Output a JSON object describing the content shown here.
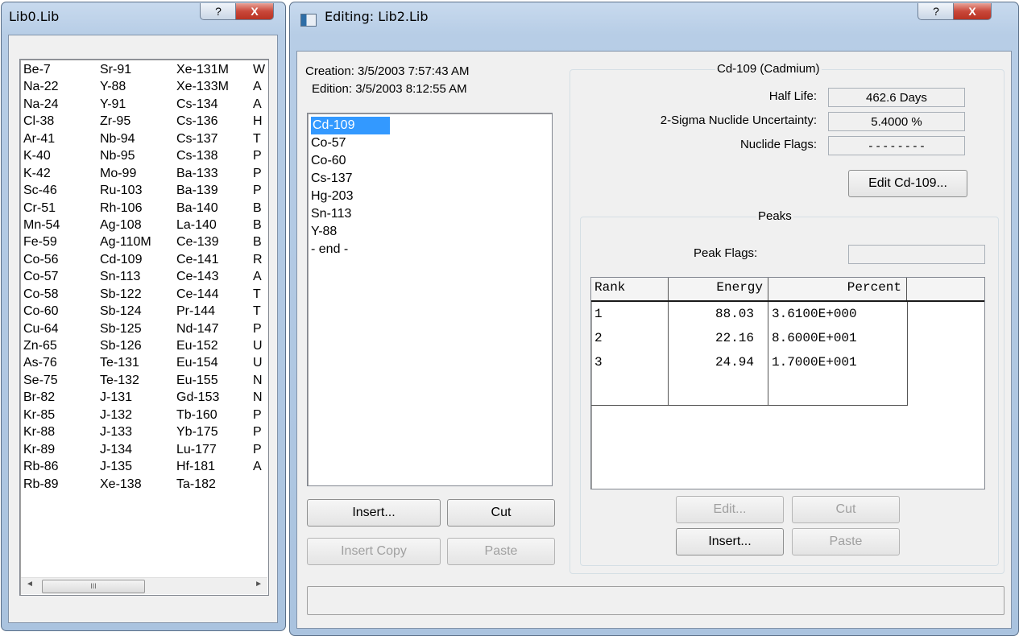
{
  "lib0": {
    "title": "Lib0.Lib",
    "help_glyph": "?",
    "close_glyph": "X",
    "columns": [
      [
        "Be-7",
        "Na-22",
        "Na-24",
        "Cl-38",
        "Ar-41",
        "K-40",
        "K-42",
        "Sc-46",
        "Cr-51",
        "Mn-54",
        "Fe-59",
        "Co-56",
        "Co-57",
        "Co-58",
        "Co-60",
        "Cu-64",
        "Zn-65",
        "As-76",
        "Se-75",
        "Br-82",
        "Kr-85",
        "Kr-88",
        "Kr-89",
        "Rb-86",
        "Rb-89"
      ],
      [
        "Sr-91",
        "Y-88",
        "Y-91",
        "Zr-95",
        "Nb-94",
        "Nb-95",
        "Mo-99",
        "Ru-103",
        "Rh-106",
        "Ag-108",
        "Ag-110M",
        "Cd-109",
        "Sn-113",
        "Sb-122",
        "Sb-124",
        "Sb-125",
        "Sb-126",
        "Te-131",
        "Te-132",
        "J-131",
        "J-132",
        "J-133",
        "J-134",
        "J-135",
        "Xe-138"
      ],
      [
        "Xe-131M",
        "Xe-133M",
        "Cs-134",
        "Cs-136",
        "Cs-137",
        "Cs-138",
        "Ba-133",
        "Ba-139",
        "Ba-140",
        "La-140",
        "Ce-139",
        "Ce-141",
        "Ce-143",
        "Ce-144",
        "Pr-144",
        "Nd-147",
        "Eu-152",
        "Eu-154",
        "Eu-155",
        "Gd-153",
        "Tb-160",
        "Yb-175",
        "Lu-177",
        "Hf-181",
        "Ta-182"
      ],
      [
        "W",
        "A",
        "A",
        "H",
        "T",
        "P",
        "P",
        "P",
        "B",
        "B",
        "B",
        "R",
        "A",
        "T",
        "T",
        "P",
        "U",
        "U",
        "N",
        "N",
        "P",
        "P",
        "P",
        "A",
        ""
      ]
    ],
    "scroll_left": "◄",
    "scroll_thumb": "III",
    "scroll_right": "►"
  },
  "editor": {
    "title": "Editing: Lib2.Lib",
    "help_glyph": "?",
    "close_glyph": "X",
    "creation": "Creation: 3/5/2003  7:57:43 AM",
    "edition": "Edition: 3/5/2003  8:12:55 AM",
    "nuclides": [
      "Cd-109",
      "Co-57",
      "Co-60",
      "Cs-137",
      "Hg-203",
      "Sn-113",
      "Y-88",
      "- end -"
    ],
    "buttons": {
      "insert": "Insert...",
      "cut": "Cut",
      "insert_copy": "Insert Copy",
      "paste": "Paste"
    },
    "nuclide_group": {
      "title": "Cd-109 (Cadmium)",
      "half_life_label": "Half Life:",
      "half_life": "462.6 Days",
      "uncertainty_label": "2-Sigma Nuclide Uncertainty:",
      "uncertainty": "5.4000 %",
      "flags_label": "Nuclide Flags:",
      "flags": "- - - - - - - -",
      "edit_button": "Edit Cd-109..."
    },
    "peaks": {
      "title": "Peaks",
      "flags_label": "Peak Flags:",
      "flags": "",
      "headers": [
        "Rank",
        "Energy",
        "Percent"
      ],
      "rows": [
        [
          "1",
          "88.03",
          "3.6100E+000"
        ],
        [
          "2",
          "22.16",
          "8.6000E+001"
        ],
        [
          "3",
          "24.94",
          "1.7000E+001"
        ]
      ],
      "buttons": {
        "edit": "Edit...",
        "cut": "Cut",
        "insert": "Insert...",
        "paste": "Paste"
      }
    },
    "status": ""
  }
}
